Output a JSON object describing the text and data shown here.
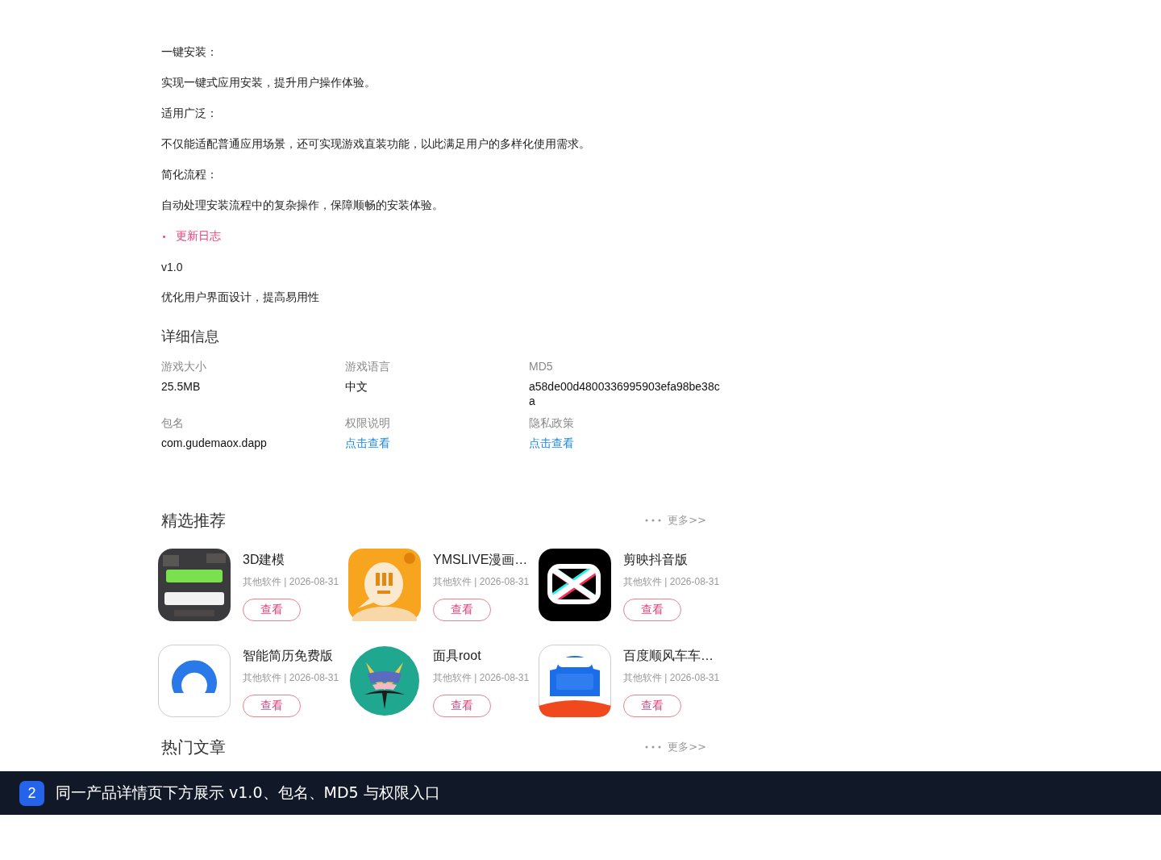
{
  "article": [
    {
      "kind": "text",
      "text": "一键安装："
    },
    {
      "kind": "text",
      "text": "实现一键式应用安装，提升用户操作体验。"
    },
    {
      "kind": "text",
      "text": "适用广泛："
    },
    {
      "kind": "text",
      "text": "不仅能适配普通应用场景，还可实现游戏直装功能，以此满足用户的多样化使用需求。"
    },
    {
      "kind": "text",
      "text": "简化流程："
    },
    {
      "kind": "text",
      "text": "自动处理安装流程中的复杂操作，保障顺畅的安装体验。"
    },
    {
      "kind": "bullet_heading",
      "text": "更新日志"
    },
    {
      "kind": "version",
      "text": "v1.0"
    },
    {
      "kind": "text",
      "text": "优化用户界面设计，提高易用性"
    }
  ],
  "details": {
    "title": "详细信息",
    "fields": [
      {
        "label": "游戏大小",
        "value": "25.5MB",
        "kind": "text"
      },
      {
        "label": "游戏语言",
        "value": "中文",
        "kind": "text"
      },
      {
        "label": "MD5",
        "value": "a58de00d4800336995903efa98be38ca",
        "kind": "text"
      },
      {
        "label": "包名",
        "value": "com.gudemaox.dapp",
        "kind": "text"
      },
      {
        "label": "权限说明",
        "value": "点击查看",
        "kind": "link"
      },
      {
        "label": "隐私政策",
        "value": "点击查看",
        "kind": "link"
      }
    ]
  },
  "featured": {
    "title": "精选推荐",
    "more": "更多>>",
    "apps": [
      {
        "name": "3D建模",
        "meta": "其他软件 | 2026-08-31",
        "button": "查看"
      },
      {
        "name": "YMSLIVE漫画…",
        "meta": "其他软件 | 2026-08-31",
        "button": "查看"
      },
      {
        "name": "剪映抖音版",
        "meta": "其他软件 | 2026-08-31",
        "button": "查看"
      },
      {
        "name": "智能简历免费版",
        "meta": "其他软件 | 2026-08-31",
        "button": "查看"
      },
      {
        "name": "面具root",
        "meta": "其他软件 | 2026-08-31",
        "button": "查看"
      },
      {
        "name": "百度顺风车车…",
        "meta": "其他软件 | 2026-08-31",
        "button": "查看"
      }
    ]
  },
  "hot_articles": {
    "title": "热门文章",
    "more": "更多>>"
  },
  "caption": {
    "step": "2",
    "text": "同一产品详情页下方展示 v1.0、包名、MD5 与权限入口"
  }
}
